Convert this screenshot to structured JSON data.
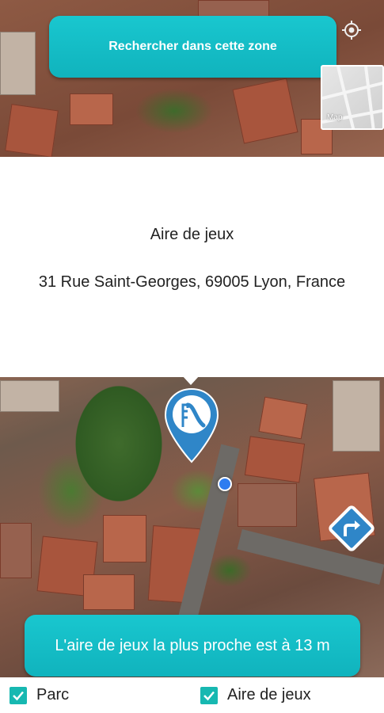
{
  "map": {
    "search_button_label": "Rechercher dans cette zone",
    "map_type_label": "Map",
    "accent_color": "#14bdc6",
    "user_location_color": "#2d7cf0",
    "marker_color": "#2f86c8"
  },
  "info_card": {
    "title": "Aire de jeux",
    "address": "31 Rue Saint-Georges, 69005 Lyon, France"
  },
  "nearest_banner": {
    "text": "L'aire de jeux la plus proche est à 13 m"
  },
  "filters": [
    {
      "label": "Parc",
      "checked": true
    },
    {
      "label": "Aire de jeux",
      "checked": true
    }
  ],
  "icons": {
    "locate": "my-location-icon",
    "marker": "playground-slide-icon",
    "directions": "turn-right-arrow-icon",
    "checkbox": "checkmark-icon"
  }
}
